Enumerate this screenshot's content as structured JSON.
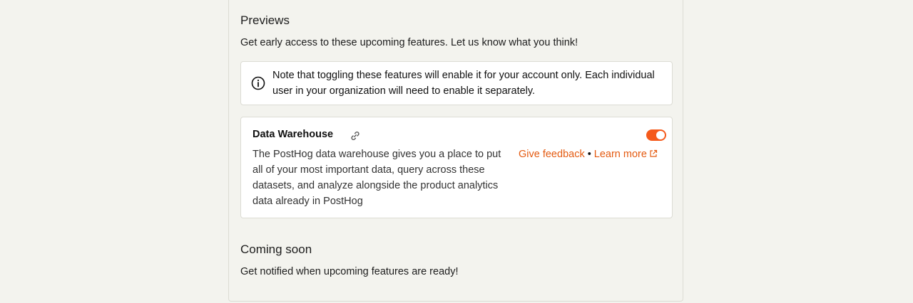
{
  "previews": {
    "title": "Previews",
    "description": "Get early access to these upcoming features. Let us know what you think!",
    "note": {
      "icon": "info-icon",
      "text": "Note that toggling these features will enable it for your account only. Each individual user in your organization will need to enable it separately."
    },
    "features": [
      {
        "name": "Data Warehouse",
        "link_icon": "link-icon",
        "description": "The PostHog data warehouse gives you a place to put all of your most important data, query across these datasets, and analyze alongside the product analytics data already in PostHog",
        "feedback_label": "Give feedback",
        "separator": "•",
        "learn_more_label": "Learn more",
        "learn_more_icon": "external-link-icon",
        "enabled": true
      }
    ]
  },
  "coming_soon": {
    "title": "Coming soon",
    "description": "Get notified when upcoming features are ready!"
  },
  "colors": {
    "accent": "#e45a10",
    "toggle_on": "#f55a1b",
    "background": "#f3f3ee",
    "card_background": "#ffffff",
    "border": "#dcdcd4"
  }
}
